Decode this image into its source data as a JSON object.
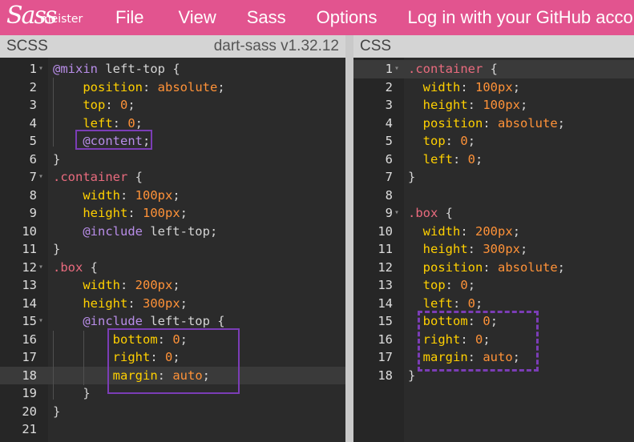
{
  "menubar": {
    "logo_sass": "Sass",
    "logo_meister": "meister",
    "items": [
      "File",
      "View",
      "Sass",
      "Options",
      "Log in with your GitHub account"
    ]
  },
  "scss_pane": {
    "title": "SCSS",
    "version": "dart-sass v1.32.12",
    "active_line": 18,
    "fold_lines": [
      1,
      7,
      12,
      15
    ],
    "lines": [
      [
        [
          "at",
          "@mixin"
        ],
        [
          "plain",
          " left-top {"
        ]
      ],
      [
        [
          "plain",
          "    "
        ],
        [
          "prop",
          "position"
        ],
        [
          "plain",
          ": "
        ],
        [
          "val",
          "absolute"
        ],
        [
          "plain",
          ";"
        ]
      ],
      [
        [
          "plain",
          "    "
        ],
        [
          "prop",
          "top"
        ],
        [
          "plain",
          ": "
        ],
        [
          "val",
          "0"
        ],
        [
          "plain",
          ";"
        ]
      ],
      [
        [
          "plain",
          "    "
        ],
        [
          "prop",
          "left"
        ],
        [
          "plain",
          ": "
        ],
        [
          "val",
          "0"
        ],
        [
          "plain",
          ";"
        ]
      ],
      [
        [
          "plain",
          "    "
        ],
        [
          "at",
          "@content"
        ],
        [
          "plain",
          ";"
        ]
      ],
      [
        [
          "plain",
          "}"
        ]
      ],
      [
        [
          "sel",
          ".container"
        ],
        [
          "plain",
          " {"
        ]
      ],
      [
        [
          "plain",
          "    "
        ],
        [
          "prop",
          "width"
        ],
        [
          "plain",
          ": "
        ],
        [
          "val",
          "100px"
        ],
        [
          "plain",
          ";"
        ]
      ],
      [
        [
          "plain",
          "    "
        ],
        [
          "prop",
          "height"
        ],
        [
          "plain",
          ": "
        ],
        [
          "val",
          "100px"
        ],
        [
          "plain",
          ";"
        ]
      ],
      [
        [
          "plain",
          "    "
        ],
        [
          "at",
          "@include"
        ],
        [
          "plain",
          " left-top;"
        ]
      ],
      [
        [
          "plain",
          "}"
        ]
      ],
      [
        [
          "sel",
          ".box"
        ],
        [
          "plain",
          " {"
        ]
      ],
      [
        [
          "plain",
          "    "
        ],
        [
          "prop",
          "width"
        ],
        [
          "plain",
          ": "
        ],
        [
          "val",
          "200px"
        ],
        [
          "plain",
          ";"
        ]
      ],
      [
        [
          "plain",
          "    "
        ],
        [
          "prop",
          "height"
        ],
        [
          "plain",
          ": "
        ],
        [
          "val",
          "300px"
        ],
        [
          "plain",
          ";"
        ]
      ],
      [
        [
          "plain",
          "    "
        ],
        [
          "at",
          "@include"
        ],
        [
          "plain",
          " left-top {"
        ]
      ],
      [
        [
          "plain",
          "        "
        ],
        [
          "prop",
          "bottom"
        ],
        [
          "plain",
          ": "
        ],
        [
          "val",
          "0"
        ],
        [
          "plain",
          ";"
        ]
      ],
      [
        [
          "plain",
          "        "
        ],
        [
          "prop",
          "right"
        ],
        [
          "plain",
          ": "
        ],
        [
          "val",
          "0"
        ],
        [
          "plain",
          ";"
        ]
      ],
      [
        [
          "plain",
          "        "
        ],
        [
          "prop",
          "margin"
        ],
        [
          "plain",
          ": "
        ],
        [
          "val",
          "auto"
        ],
        [
          "plain",
          ";"
        ]
      ],
      [
        [
          "plain",
          "    }"
        ]
      ],
      [
        [
          "plain",
          "}"
        ]
      ],
      []
    ]
  },
  "css_pane": {
    "title": "CSS",
    "active_line": 1,
    "fold_lines": [
      1,
      9
    ],
    "lines": [
      [
        [
          "sel",
          ".container"
        ],
        [
          "plain",
          " {"
        ]
      ],
      [
        [
          "plain",
          "  "
        ],
        [
          "prop",
          "width"
        ],
        [
          "plain",
          ": "
        ],
        [
          "val",
          "100px"
        ],
        [
          "plain",
          ";"
        ]
      ],
      [
        [
          "plain",
          "  "
        ],
        [
          "prop",
          "height"
        ],
        [
          "plain",
          ": "
        ],
        [
          "val",
          "100px"
        ],
        [
          "plain",
          ";"
        ]
      ],
      [
        [
          "plain",
          "  "
        ],
        [
          "prop",
          "position"
        ],
        [
          "plain",
          ": "
        ],
        [
          "val",
          "absolute"
        ],
        [
          "plain",
          ";"
        ]
      ],
      [
        [
          "plain",
          "  "
        ],
        [
          "prop",
          "top"
        ],
        [
          "plain",
          ": "
        ],
        [
          "val",
          "0"
        ],
        [
          "plain",
          ";"
        ]
      ],
      [
        [
          "plain",
          "  "
        ],
        [
          "prop",
          "left"
        ],
        [
          "plain",
          ": "
        ],
        [
          "val",
          "0"
        ],
        [
          "plain",
          ";"
        ]
      ],
      [
        [
          "plain",
          "}"
        ]
      ],
      [],
      [
        [
          "sel",
          ".box"
        ],
        [
          "plain",
          " {"
        ]
      ],
      [
        [
          "plain",
          "  "
        ],
        [
          "prop",
          "width"
        ],
        [
          "plain",
          ": "
        ],
        [
          "val",
          "200px"
        ],
        [
          "plain",
          ";"
        ]
      ],
      [
        [
          "plain",
          "  "
        ],
        [
          "prop",
          "height"
        ],
        [
          "plain",
          ": "
        ],
        [
          "val",
          "300px"
        ],
        [
          "plain",
          ";"
        ]
      ],
      [
        [
          "plain",
          "  "
        ],
        [
          "prop",
          "position"
        ],
        [
          "plain",
          ": "
        ],
        [
          "val",
          "absolute"
        ],
        [
          "plain",
          ";"
        ]
      ],
      [
        [
          "plain",
          "  "
        ],
        [
          "prop",
          "top"
        ],
        [
          "plain",
          ": "
        ],
        [
          "val",
          "0"
        ],
        [
          "plain",
          ";"
        ]
      ],
      [
        [
          "plain",
          "  "
        ],
        [
          "prop",
          "left"
        ],
        [
          "plain",
          ": "
        ],
        [
          "val",
          "0"
        ],
        [
          "plain",
          ";"
        ]
      ],
      [
        [
          "plain",
          "  "
        ],
        [
          "prop",
          "bottom"
        ],
        [
          "plain",
          ": "
        ],
        [
          "val",
          "0"
        ],
        [
          "plain",
          ";"
        ]
      ],
      [
        [
          "plain",
          "  "
        ],
        [
          "prop",
          "right"
        ],
        [
          "plain",
          ": "
        ],
        [
          "val",
          "0"
        ],
        [
          "plain",
          ";"
        ]
      ],
      [
        [
          "plain",
          "  "
        ],
        [
          "prop",
          "margin"
        ],
        [
          "plain",
          ": "
        ],
        [
          "val",
          "auto"
        ],
        [
          "plain",
          ";"
        ]
      ],
      [
        [
          "plain",
          "}"
        ]
      ]
    ]
  },
  "colors": {
    "menubar": "#e2548f",
    "editor_bg": "#2b2b2b",
    "highlight_box": "#7b3db6"
  }
}
